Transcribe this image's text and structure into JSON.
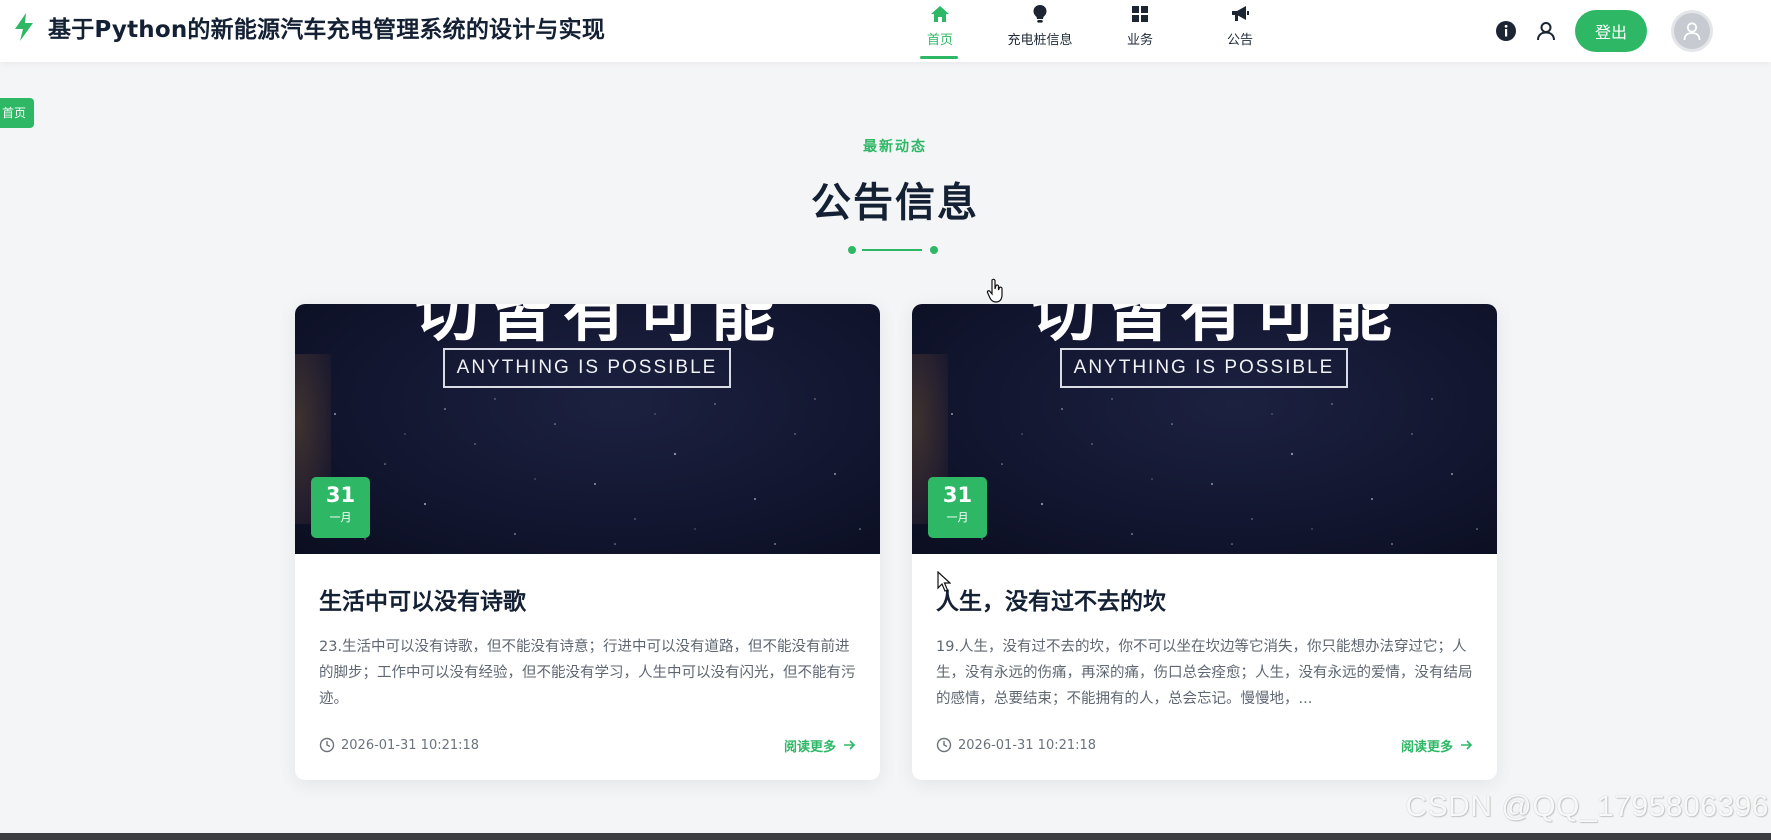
{
  "header": {
    "title": "基于Python的新能源汽车充电管理系统的设计与实现",
    "nav": [
      {
        "label": "首页",
        "icon": "home-icon",
        "active": true
      },
      {
        "label": "充电桩信息",
        "icon": "lightbulb-icon",
        "active": false
      },
      {
        "label": "业务",
        "icon": "grid-icon",
        "active": false
      },
      {
        "label": "公告",
        "icon": "megaphone-icon",
        "active": false
      }
    ],
    "logout_label": "登出",
    "right_icons": [
      "info-icon",
      "user-icon",
      "avatar"
    ]
  },
  "breadcrumb": "首页",
  "section": {
    "subtitle": "最新动态",
    "title": "公告信息"
  },
  "cards": [
    {
      "image_big_text": "切皆有可能",
      "image_tagline": "ANYTHING IS POSSIBLE",
      "day": "31",
      "month": "一月",
      "title": "生活中可以没有诗歌",
      "text": "23.生活中可以没有诗歌，但不能没有诗意；行进中可以没有道路，但不能没有前进的脚步；工作中可以没有经验，但不能没有学习，人生中可以没有闪光，但不能有污迹。",
      "time": "2026-01-31 10:21:18",
      "read_more": "阅读更多"
    },
    {
      "image_big_text": "切皆有可能",
      "image_tagline": "ANYTHING IS POSSIBLE",
      "day": "31",
      "month": "一月",
      "title": "人生，没有过不去的坎",
      "text": "19.人生，没有过不去的坎，你不可以坐在坎边等它消失，你只能想办法穿过它；人生，没有永远的伤痛，再深的痛，伤口总会痊愈；人生，没有永远的爱情，没有结局的感情，总要结束；不能拥有的人，总会忘记。慢慢地，...",
      "time": "2026-01-31 10:21:18",
      "read_more": "阅读更多"
    }
  ],
  "watermark": "CSDN @QQ_1795806396",
  "colors": {
    "accent": "#2eb866",
    "title": "#142033",
    "background": "#f4f5f6"
  }
}
